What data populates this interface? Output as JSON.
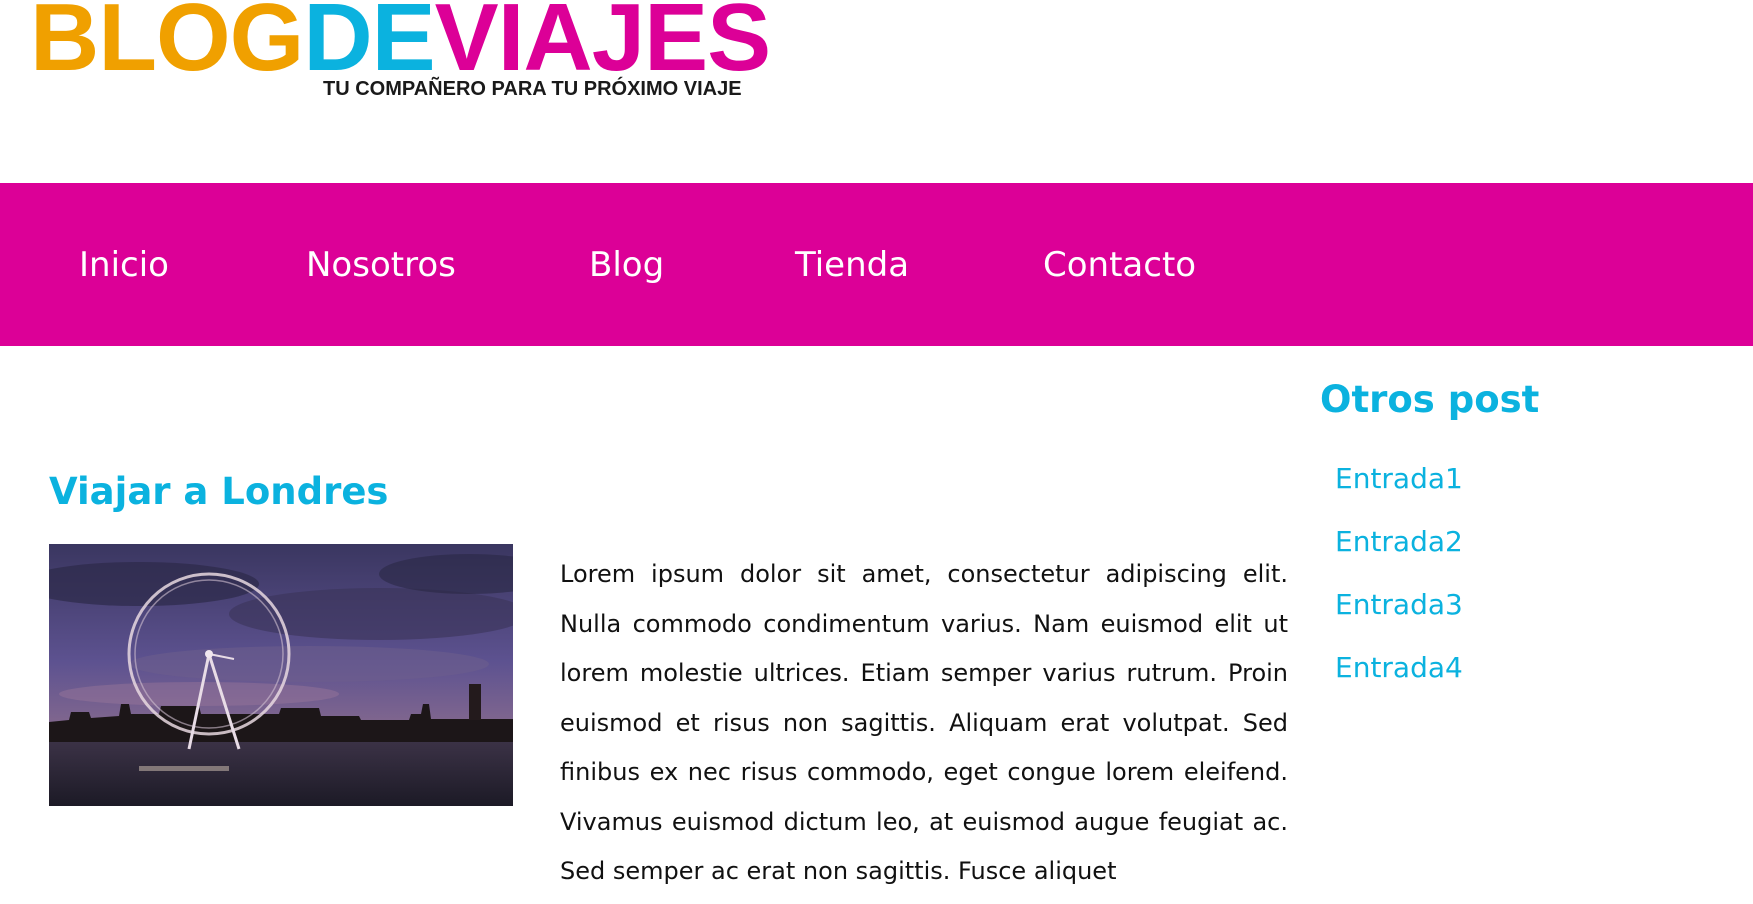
{
  "logo": {
    "part1": "BLOG",
    "part2": "DE",
    "part3": "VIAJES",
    "tagline": "TU COMPAÑERO PARA TU PRÓXIMO VIAJE",
    "colors": {
      "part1": "#f0a000",
      "part2": "#0bb2df",
      "part3": "#dc0097"
    }
  },
  "nav": {
    "background": "#dc0097",
    "items": [
      {
        "label": "Inicio"
      },
      {
        "label": "Nosotros"
      },
      {
        "label": "Blog"
      },
      {
        "label": "Tienda"
      },
      {
        "label": "Contacto"
      }
    ]
  },
  "post": {
    "title": "Viajar a Londres",
    "image_icon": "london-eye-photo",
    "text": "Lorem ipsum dolor sit amet, consectetur adipiscing elit. Nulla commodo condimentum varius. Nam euismod elit ut lorem molestie ultrices. Etiam semper varius rutrum. Proin euismod et risus non sagittis. Aliquam erat volutpat. Sed finibus ex nec risus commodo, eget congue lorem eleifend. Vivamus euismod dictum leo, at euismod augue feugiat ac. Sed semper ac erat non sagittis. Fusce aliquet"
  },
  "sidebar": {
    "title": "Otros post",
    "items": [
      {
        "label": "Entrada1"
      },
      {
        "label": "Entrada2"
      },
      {
        "label": "Entrada3"
      },
      {
        "label": "Entrada4"
      }
    ]
  },
  "colors": {
    "accent": "#0bb2df",
    "text": "#111111"
  }
}
